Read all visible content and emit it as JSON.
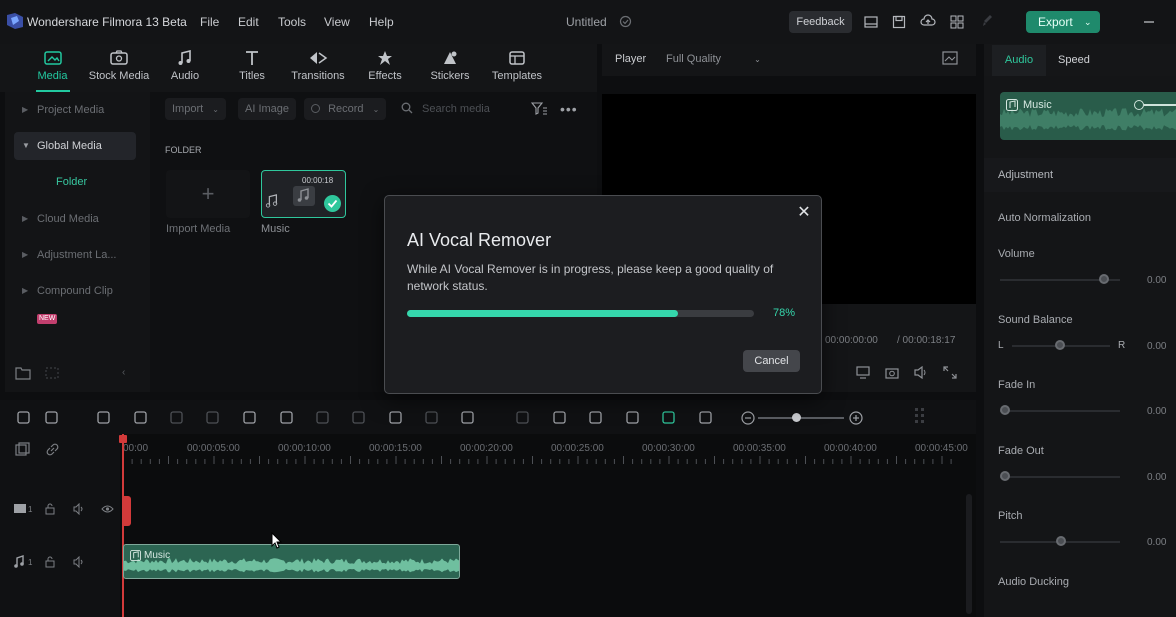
{
  "app": {
    "title": "Wondershare Filmora 13 Beta",
    "menu": [
      "File",
      "Edit",
      "Tools",
      "View",
      "Help"
    ],
    "document": "Untitled",
    "feedback_label": "Feedback",
    "export_label": "Export",
    "accent": "#22c9a0"
  },
  "toolbar": {
    "tabs": [
      {
        "label": "Media",
        "icon": "media-icon",
        "active": true
      },
      {
        "label": "Stock Media",
        "icon": "stock-media-icon"
      },
      {
        "label": "Audio",
        "icon": "music-note-icon"
      },
      {
        "label": "Titles",
        "icon": "text-icon"
      },
      {
        "label": "Transitions",
        "icon": "transitions-icon"
      },
      {
        "label": "Effects",
        "icon": "effects-icon"
      },
      {
        "label": "Stickers",
        "icon": "stickers-icon"
      },
      {
        "label": "Templates",
        "icon": "templates-icon"
      }
    ]
  },
  "sidebar": {
    "items": [
      {
        "label": "Project Media"
      },
      {
        "label": "Global Media"
      },
      {
        "label": "Folder"
      },
      {
        "label": "Cloud Media"
      },
      {
        "label": "Adjustment La..."
      },
      {
        "label": "Compound Clip"
      }
    ],
    "hot_badge": "NEW"
  },
  "media": {
    "import_label": "Import",
    "ai_image_label": "AI Image",
    "record_label": "Record",
    "search_placeholder": "Search media",
    "folder_heading": "FOLDER",
    "import_tile_label": "Import Media",
    "music_tile_label": "Music",
    "music_duration": "00:00:18"
  },
  "player": {
    "label": "Player",
    "quality": "Full Quality",
    "current_time": "00:00:00:00",
    "total_time": "/ 00:00:18:17"
  },
  "right_panel": {
    "tab_audio": "Audio",
    "tab_speed": "Speed",
    "clip_name": "Music",
    "adjustment": "Adjustment",
    "auto_normalization": "Auto Normalization",
    "volume_label": "Volume",
    "volume_value": "0.00",
    "sound_balance_label": "Sound Balance",
    "balance_left": "L",
    "balance_right": "R",
    "balance_value": "0.00",
    "fade_in_label": "Fade In",
    "fade_in_value": "0.00",
    "fade_out_label": "Fade Out",
    "fade_out_value": "0.00",
    "pitch_label": "Pitch",
    "pitch_value": "0.00",
    "audio_ducking_label": "Audio Ducking"
  },
  "timeline": {
    "ruler": [
      "00:00",
      "00:00:05:00",
      "00:00:10:00",
      "00:00:15:00",
      "00:00:20:00",
      "00:00:25:00",
      "00:00:30:00",
      "00:00:35:00",
      "00:00:40:00",
      "00:00:45:00"
    ],
    "clip_label": "Music"
  },
  "dialog": {
    "title": "AI Vocal Remover",
    "message": "While AI Vocal Remover is in progress, please keep a good quality of network status.",
    "progress": 0.78,
    "progress_label": "78%",
    "cancel_label": "Cancel",
    "close_glyph": "✕"
  }
}
